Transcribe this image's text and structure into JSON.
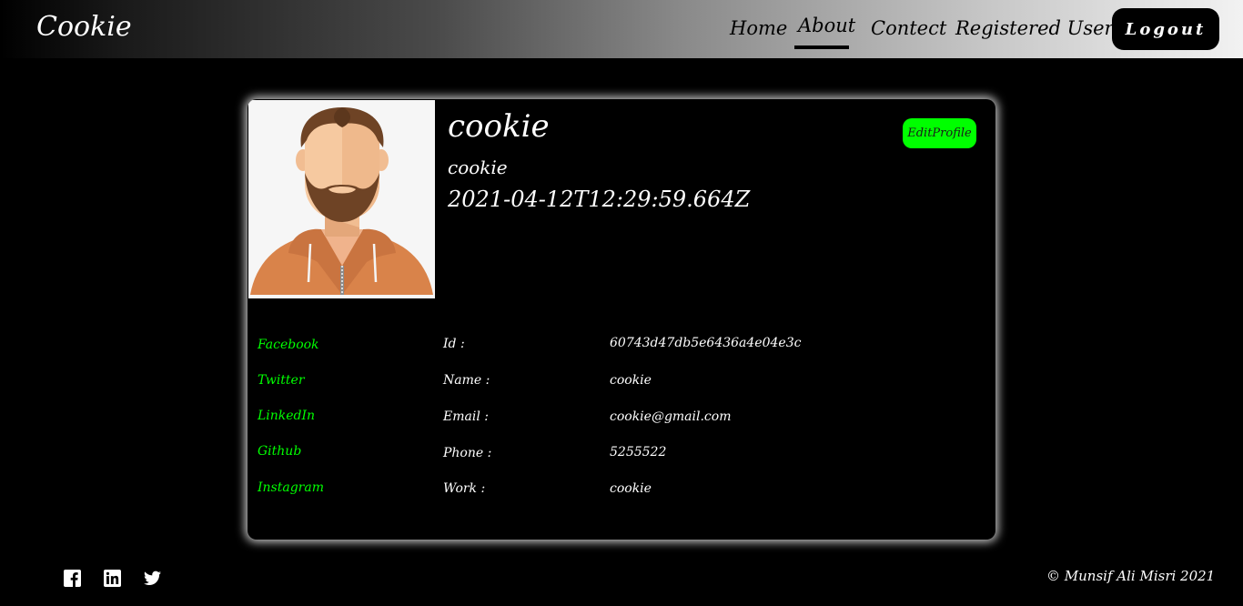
{
  "navbar": {
    "brand": "Cookie",
    "links": [
      "Home",
      "About",
      "Contect",
      "Registered Users"
    ],
    "active": "About",
    "logout_label": "Logout"
  },
  "profile": {
    "name": "cookie",
    "work": "cookie",
    "date": "2021-04-12T12:29:59.664Z",
    "edit_label": "EditProfile",
    "edit_color": "#00ff00"
  },
  "social_links": [
    "Facebook",
    "Twitter",
    "LinkedIn",
    "Github",
    "Instagram"
  ],
  "details": [
    {
      "label": "Id :",
      "value": "60743d47db5e6436a4e04e3c"
    },
    {
      "label": "Name :",
      "value": "cookie"
    },
    {
      "label": "Email :",
      "value": "cookie@gmail.com"
    },
    {
      "label": "Phone :",
      "value": "5255522"
    },
    {
      "label": "Work :",
      "value": "cookie"
    }
  ],
  "footer": {
    "icons": [
      "facebook-icon",
      "linkedin-icon",
      "twitter-icon"
    ],
    "copyright": "© Munsif Ali Misri 2021"
  }
}
